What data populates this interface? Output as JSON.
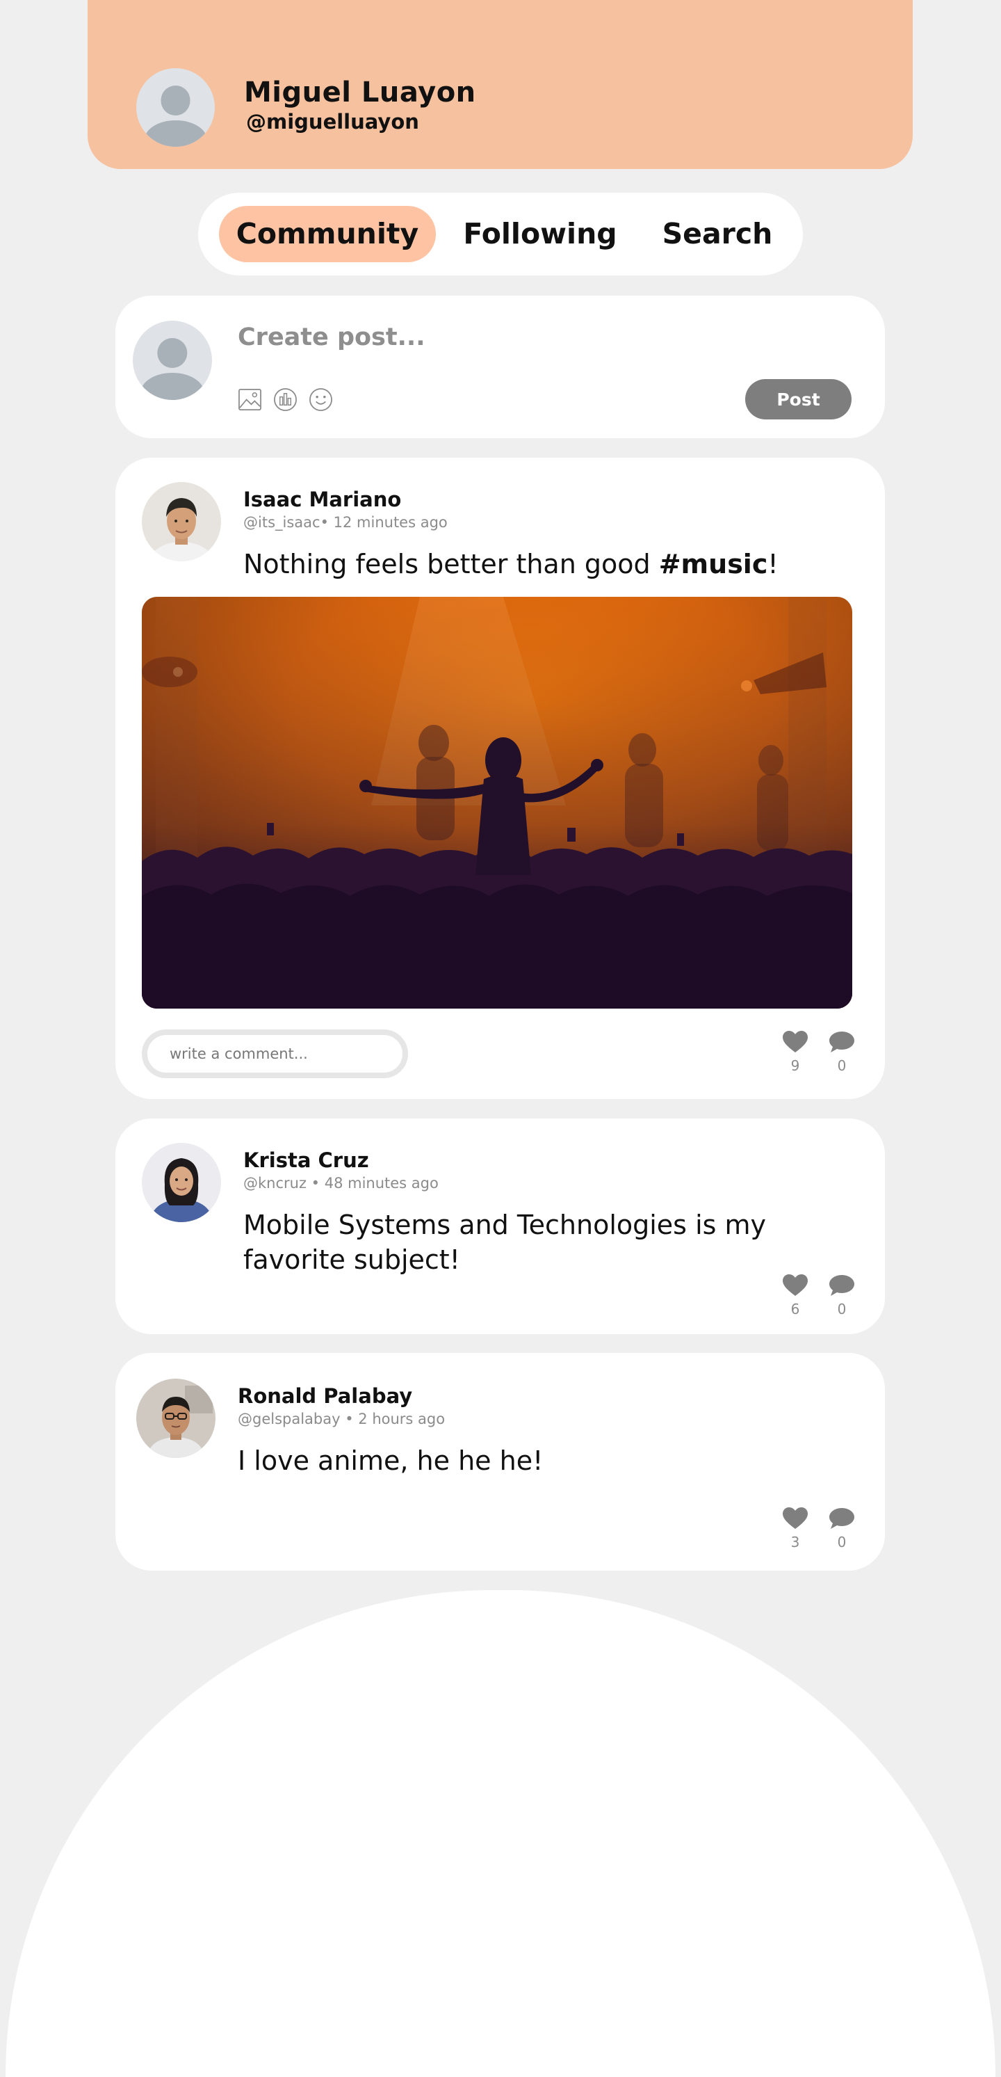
{
  "profile": {
    "name": "Miguel Luayon",
    "handle": "@miguelluayon"
  },
  "tabs": [
    {
      "label": "Community",
      "active": true
    },
    {
      "label": "Following",
      "active": false
    },
    {
      "label": "Search",
      "active": false
    }
  ],
  "composer": {
    "placeholder": "Create post...",
    "post_label": "Post",
    "tools": [
      "image-icon",
      "poll-icon",
      "emoji-icon"
    ]
  },
  "posts": [
    {
      "author": "Isaac Mariano",
      "handle": "@its_isaac",
      "time": "• 12 minutes ago",
      "text_before": "Nothing feels better than good ",
      "hashtag": "#music",
      "text_after": "!",
      "has_image": true,
      "comment_placeholder": "write a comment...",
      "likes": "9",
      "comments": "0"
    },
    {
      "author": "Krista Cruz",
      "handle": "@kncruz",
      "time": " • 48 minutes ago",
      "text_line1": "Mobile Systems and Technologies is my",
      "text_line2": "favorite subject!",
      "likes": "6",
      "comments": "0"
    },
    {
      "author": "Ronald Palabay",
      "handle": "@gelspalabay",
      "time": " • 2 hours ago",
      "text": "I love anime, he he he!",
      "likes": "3",
      "comments": "0"
    }
  ],
  "colors": {
    "background": "#efefef",
    "header": "#f6c19e",
    "active_tab": "#fdc3a3",
    "button": "#7e7e7e"
  }
}
